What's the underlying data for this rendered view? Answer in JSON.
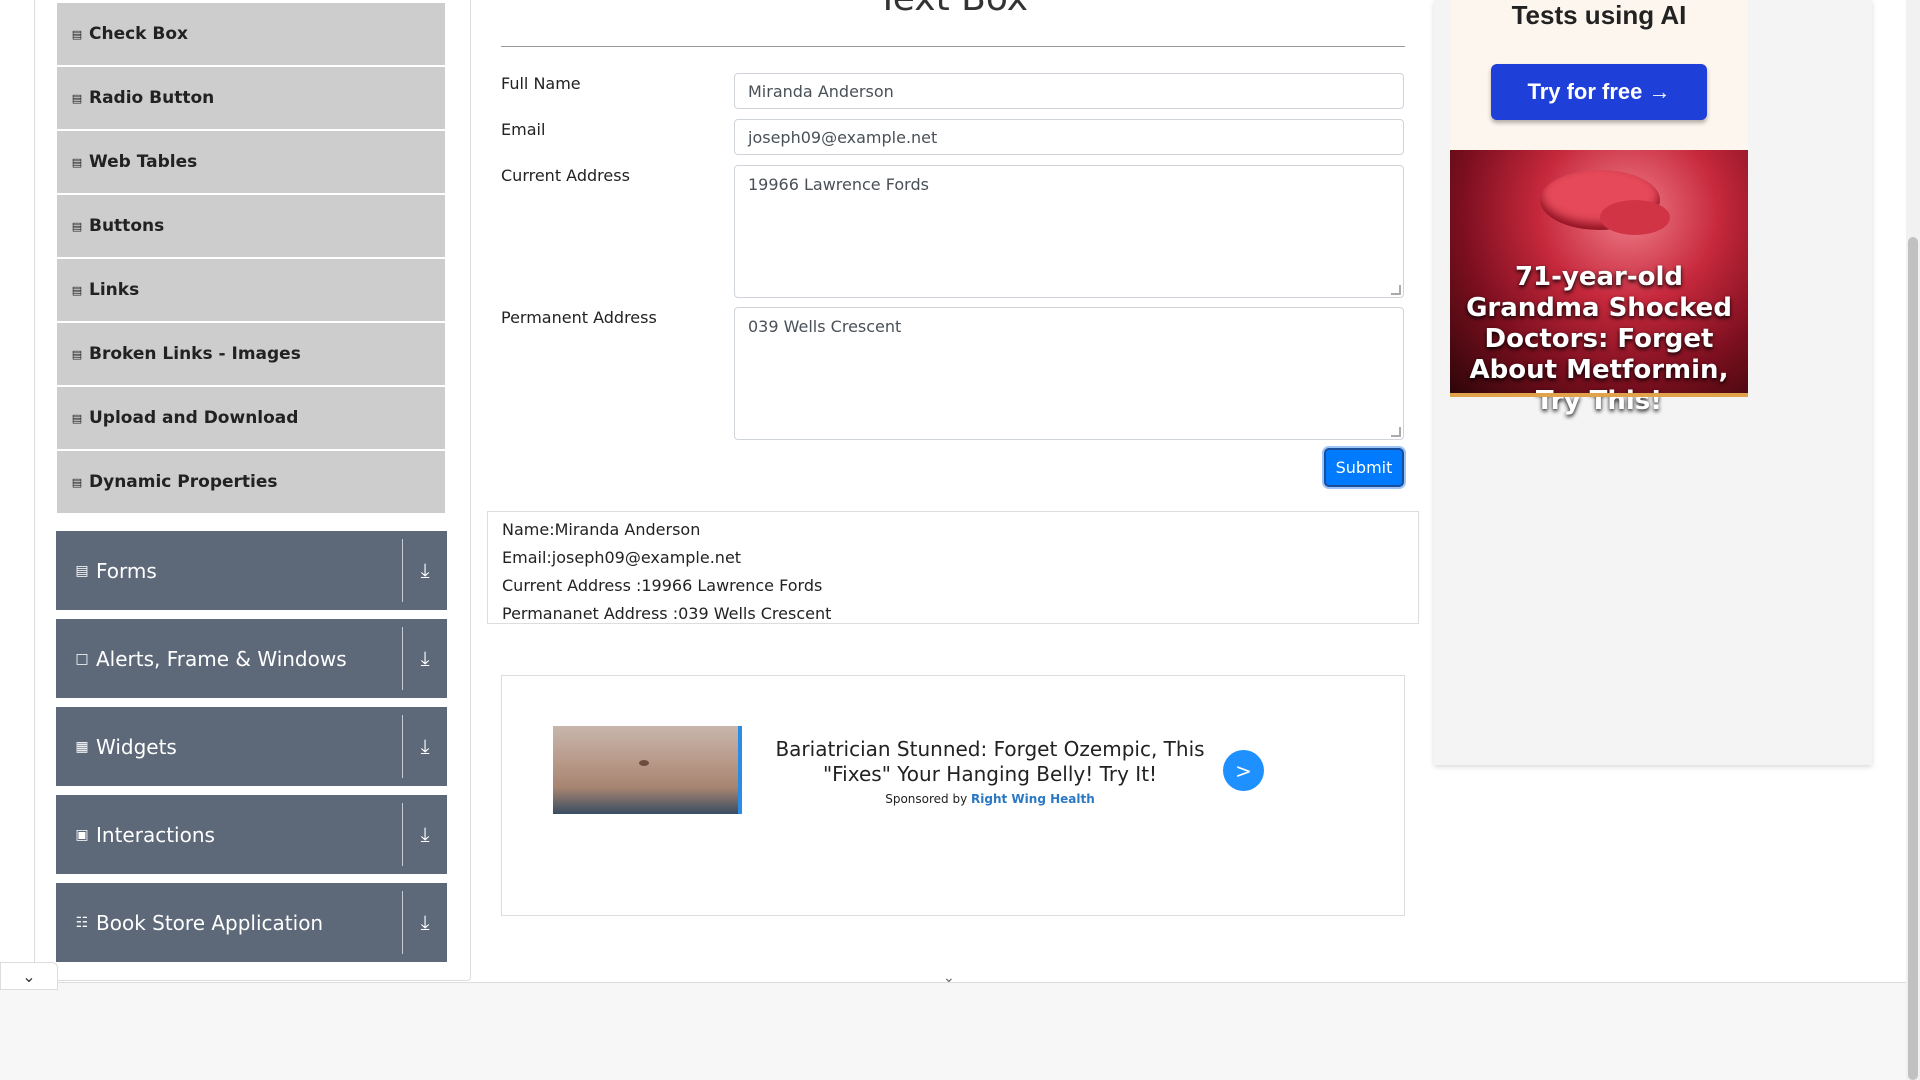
{
  "sidebar": {
    "elements_items": [
      {
        "label": "Check Box"
      },
      {
        "label": "Radio Button"
      },
      {
        "label": "Web Tables"
      },
      {
        "label": "Buttons"
      },
      {
        "label": "Links"
      },
      {
        "label": "Broken Links - Images"
      },
      {
        "label": "Upload and Download"
      },
      {
        "label": "Dynamic Properties"
      }
    ],
    "groups": [
      {
        "label": "Forms",
        "icon": "form-icon"
      },
      {
        "label": "Alerts, Frame & Windows",
        "icon": "window-icon"
      },
      {
        "label": "Widgets",
        "icon": "widgets-icon"
      },
      {
        "label": "Interactions",
        "icon": "interactions-icon"
      },
      {
        "label": "Book Store Application",
        "icon": "book-icon"
      }
    ]
  },
  "main": {
    "title": "Text Box",
    "fields": {
      "full_name_label": "Full Name",
      "full_name_value": "Miranda Anderson",
      "email_label": "Email",
      "email_value": "joseph09@example.net",
      "current_address_label": "Current Address",
      "current_address_value": "19966 Lawrence Fords",
      "permanent_address_label": "Permanent Address",
      "permanent_address_value": "039 Wells Crescent"
    },
    "submit_label": "Submit",
    "output": {
      "name": "Name:Miranda Anderson",
      "email": "Email:joseph09@example.net",
      "current_address": "Current Address :19966 Lawrence Fords",
      "permanent_address": "Permananet Address :039 Wells Crescent"
    }
  },
  "bottom_ad": {
    "headline": "Bariatrician Stunned: Forget Ozempic, This \"Fixes\" Your Hanging Belly! Try It!",
    "sponsored_prefix": "Sponsored by",
    "sponsor": "Right Wing Health",
    "arrow": ">"
  },
  "right_ad": {
    "top_text": "Tests using AI",
    "cta": "Try for free →",
    "grandma_text": "71-year-old Grandma Shocked Doctors: Forget About Metformin, Try This!"
  },
  "colors": {
    "sidebar_group": "#5d6879",
    "sidebar_item": "#cdcdcd",
    "submit": "#007bff",
    "cta": "#1e3fd8"
  }
}
